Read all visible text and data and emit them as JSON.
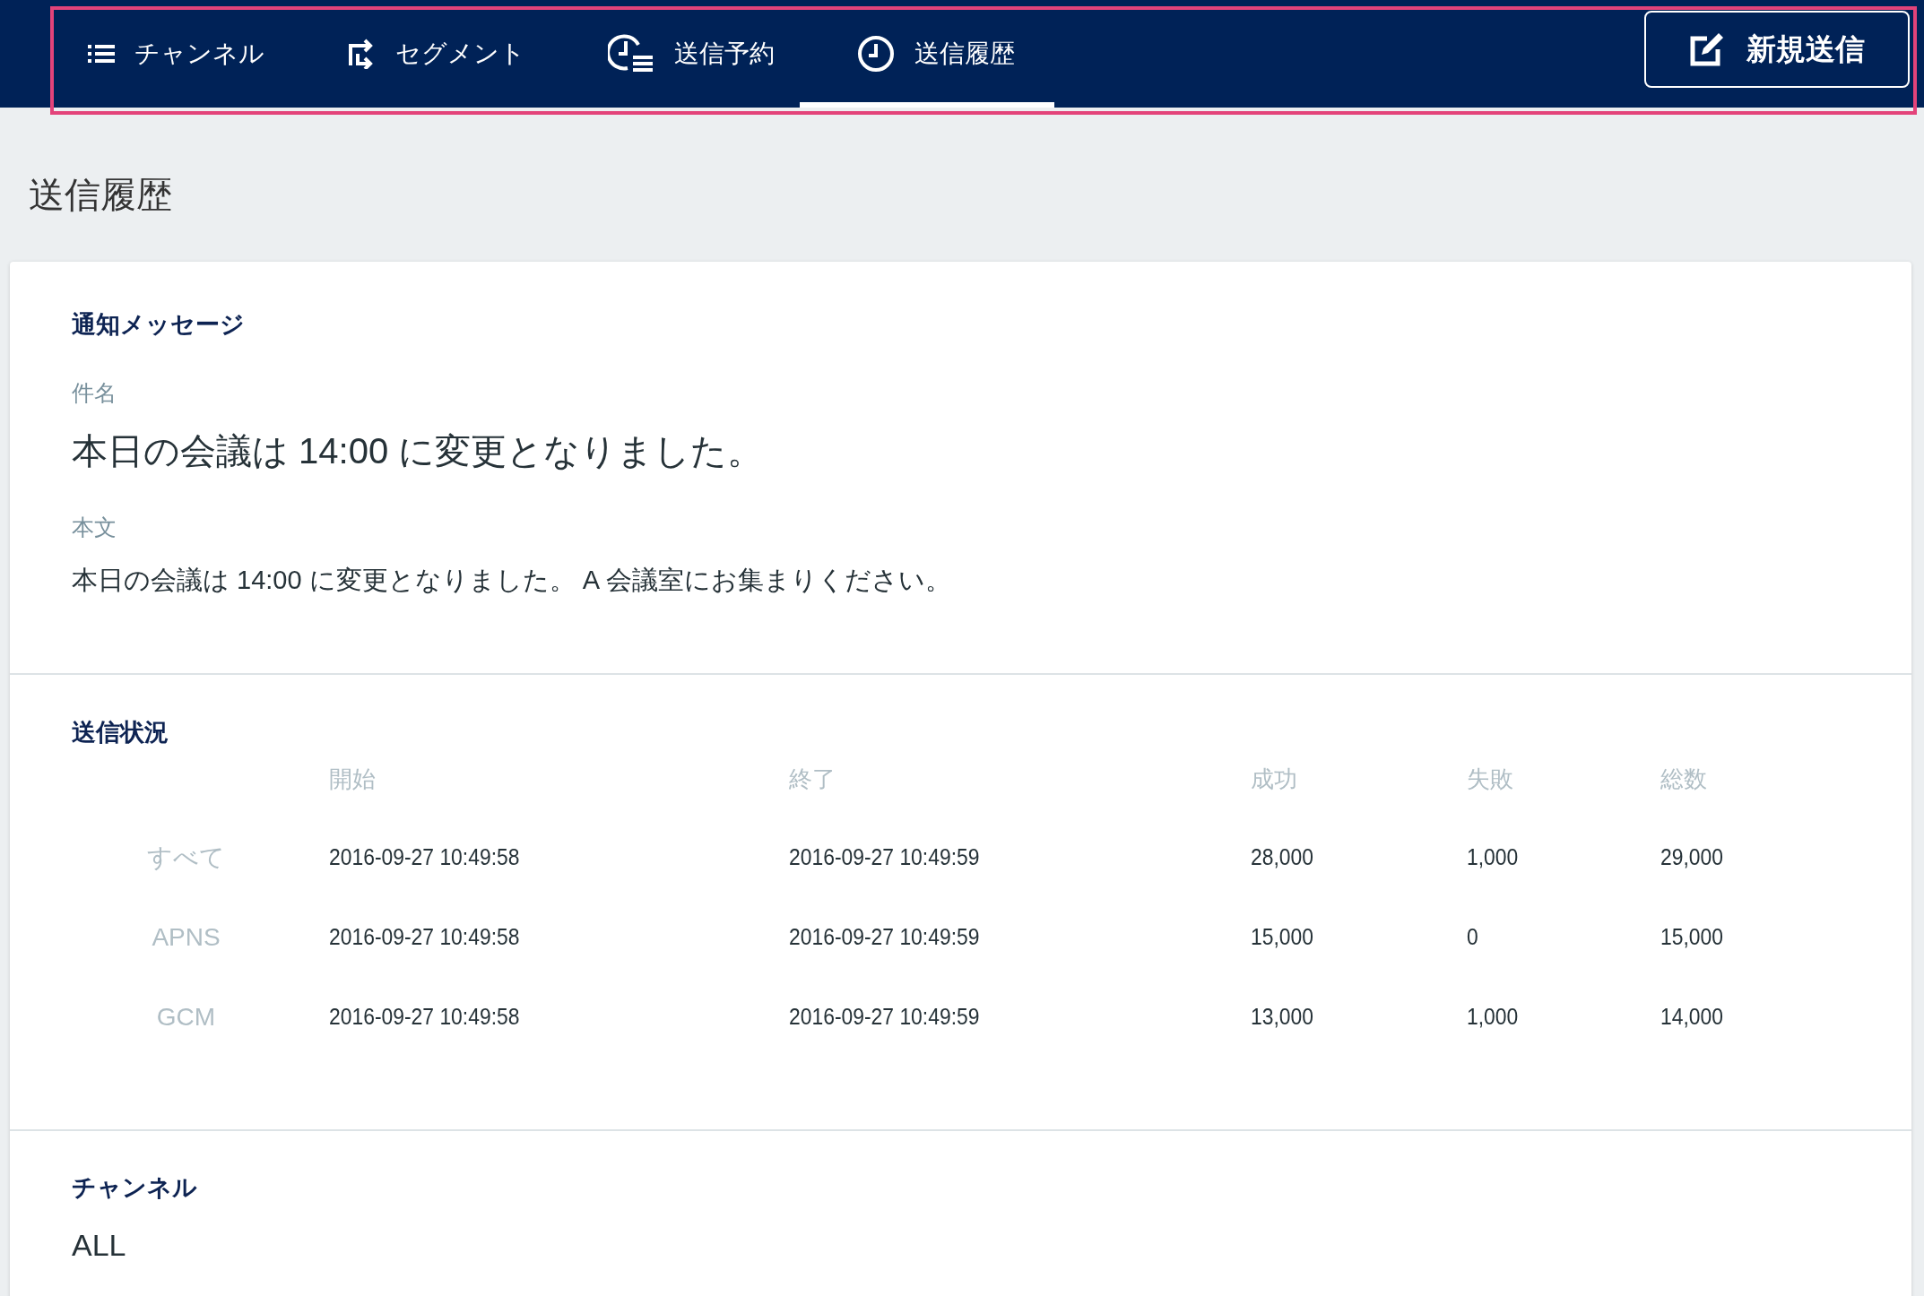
{
  "nav": {
    "tabs": [
      {
        "label": "チャンネル",
        "selected": false
      },
      {
        "label": "セグメント",
        "selected": false
      },
      {
        "label": "送信予約",
        "selected": false
      },
      {
        "label": "送信履歴",
        "selected": true
      }
    ],
    "new_button": "新規送信"
  },
  "page_title": "送信履歴",
  "message": {
    "title": "通知メッセージ",
    "subject_label": "件名",
    "subject": "本日の会議は 14:00 に変更となりました。",
    "body_label": "本文",
    "body": "本日の会議は 14:00 に変更となりました。 A 会議室にお集まりください。"
  },
  "status": {
    "title": "送信状況",
    "columns": [
      "開始",
      "終了",
      "成功",
      "失敗",
      "総数"
    ],
    "rows": [
      {
        "label": "すべて",
        "cells": [
          "2016-09-27 10:49:58",
          "2016-09-27 10:49:59",
          "28,000",
          "1,000",
          "29,000"
        ]
      },
      {
        "label": "APNS",
        "cells": [
          "2016-09-27 10:49:58",
          "2016-09-27 10:49:59",
          "15,000",
          "0",
          "15,000"
        ]
      },
      {
        "label": "GCM",
        "cells": [
          "2016-09-27 10:49:58",
          "2016-09-27 10:49:59",
          "13,000",
          "1,000",
          "14,000"
        ]
      }
    ]
  },
  "channel": {
    "title": "チャンネル",
    "value": "ALL"
  }
}
